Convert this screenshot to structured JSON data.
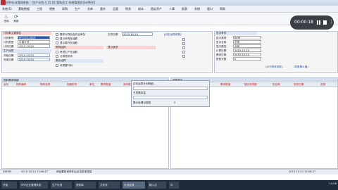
{
  "window": {
    "title": "ERP企业管理系统 - [生产计划 4.35.04  登陆员工:系统管理员(SUPER)]"
  },
  "menu": [
    "系统(S)",
    "基础数据",
    "工程",
    "销售",
    "采购",
    "生产",
    "仓库",
    "委外",
    "品管",
    "财务",
    "成本",
    "固定资产",
    "人事",
    "报表",
    "系统",
    "窗口",
    "帮助"
  ],
  "toolbar": [
    {
      "icon": "lookup-icon",
      "glyph": "♨",
      "label": "查询"
    },
    {
      "icon": "refresh-icon",
      "glyph": "⟳",
      "label": "刷新"
    }
  ],
  "recorder": {
    "time": "00:00:18"
  },
  "form": {
    "section_title": "计划单主要属性",
    "fields": [
      {
        "label": "计划单号",
        "value": "PP2019-0001"
      },
      {
        "label": "计划类型",
        "value": "订单计划"
      },
      {
        "label": "计划日期",
        "value": "2019-10-24"
      },
      {
        "label": "开始日期",
        "value": "2019-10-24"
      },
      {
        "label": "完成日期",
        "value": "2019-10-24"
      }
    ],
    "checks": [
      "需求计算包含安全库存",
      "显示采购在途数",
      "显示委外在途数",
      "考虑生产在途数",
      "计算低阶码",
      "考虑替代料"
    ],
    "sections": [
      "生产运算",
      "采购运算",
      "委外运算",
      "显示选项"
    ],
    "date_label": "交货日期",
    "date_value": "2019-10-24",
    "link_label": "[设定运算参数]"
  },
  "form2": {
    "title": "显示条件",
    "fields": [
      {
        "label": "显示类别",
        "value": "BOM"
      },
      {
        "label": "显示仓库",
        "value": "全部"
      },
      {
        "label": "显示属性",
        "value": "全部"
      },
      {
        "label": "计算日期",
        "value": "2019-10-24"
      },
      {
        "label": "需求日期",
        "value": "2019-10-24"
      },
      {
        "label": "提前天数",
        "value": "0"
      }
    ],
    "link1": "[点击修改参数]",
    "link2": "[恢复默认值]"
  },
  "grid1": {
    "title": "物料需求明细",
    "columns": [
      "序号",
      "物料编码",
      "物料名称",
      "规格型号",
      "单位",
      "需求数量",
      "库存数量",
      "在途数量"
    ]
  },
  "grid2": {
    "title": "采购建议",
    "columns": [
      "序号",
      "物料编码",
      "需求数量",
      "建议采购数",
      "供应商",
      "到货日期",
      "选择"
    ]
  },
  "popup": {
    "item1": "正在运算计划明细...",
    "item2": "子项需求量",
    "item3": "累计处理记录数",
    "value3": "0"
  },
  "status": {
    "user": "ADMIN",
    "datetime": "2019-10-24 15:06:27",
    "message": "请设置查询条件后点击查询按钮",
    "right": "2019-10-24 15:06:27"
  },
  "taskbar": [
    "开始",
    "ERP企业管理系统",
    "生产计划",
    "资料库",
    "文件夹",
    "计划运算",
    "输入法",
    "中"
  ],
  "tray_time": "15:06"
}
